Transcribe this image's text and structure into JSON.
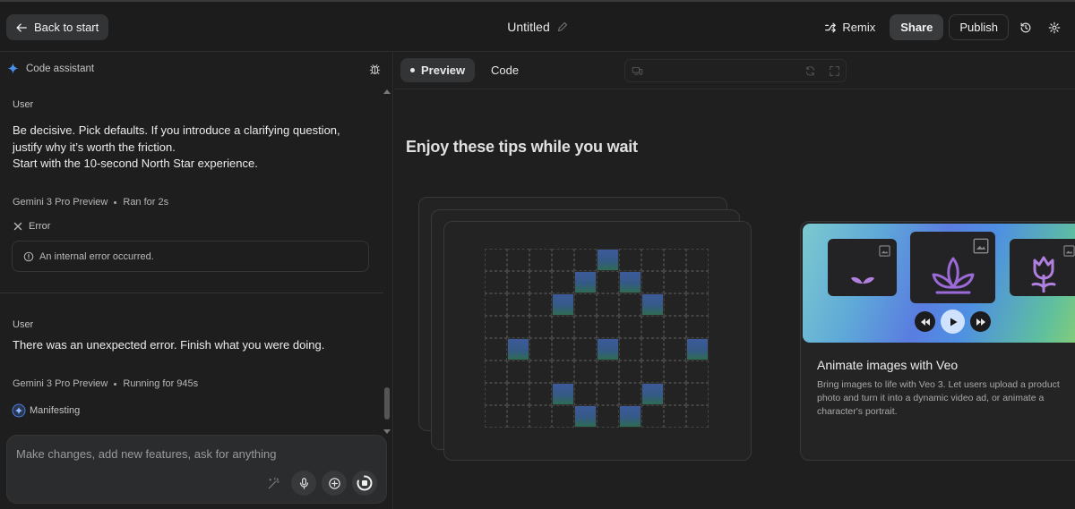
{
  "topbar": {
    "back_label": "Back to start",
    "title": "Untitled",
    "remix_label": "Remix",
    "share_label": "Share",
    "publish_label": "Publish"
  },
  "assistant": {
    "header": "Code assistant",
    "messages": [
      {
        "role": "User",
        "lines": [
          "Be decisive. Pick defaults. If you introduce a clarifying question,",
          "justify why it’s worth the friction.",
          "Start with the 10-second North Star experience."
        ]
      },
      {
        "model": "Gemini 3 Pro Preview",
        "status": "Ran for 2s",
        "error_label": "Error",
        "error_text": "An internal error occurred."
      },
      {
        "role": "User",
        "lines": [
          "There was an unexpected error. Finish what you were doing."
        ]
      },
      {
        "model": "Gemini 3 Pro Preview",
        "status": "Running for 945s",
        "activity": "Manifesting"
      }
    ],
    "composer_placeholder": "Make changes, add new features, ask for anything"
  },
  "preview": {
    "tabs": [
      "Preview",
      "Code"
    ],
    "active_tab": "Preview",
    "tips_title": "Enjoy these tips while you wait",
    "grid_cols": 10,
    "grid_rows": 8,
    "grid_active_cells": [
      [
        5,
        0
      ],
      [
        4,
        1
      ],
      [
        6,
        1
      ],
      [
        3,
        2
      ],
      [
        7,
        2
      ],
      [
        1,
        4
      ],
      [
        5,
        4
      ],
      [
        9,
        4
      ],
      [
        3,
        6
      ],
      [
        7,
        6
      ],
      [
        4,
        7
      ],
      [
        6,
        7
      ]
    ],
    "veo_card": {
      "title": "Animate images with Veo",
      "description": "Bring images to life with Veo 3. Let users upload a product photo and turn it into a dynamic video ad, or animate a character's portrait."
    }
  },
  "colors": {
    "accent_blue": "#4e8fe3",
    "flower_purple": "#9b6ad8",
    "background": "#1b1b1b"
  }
}
